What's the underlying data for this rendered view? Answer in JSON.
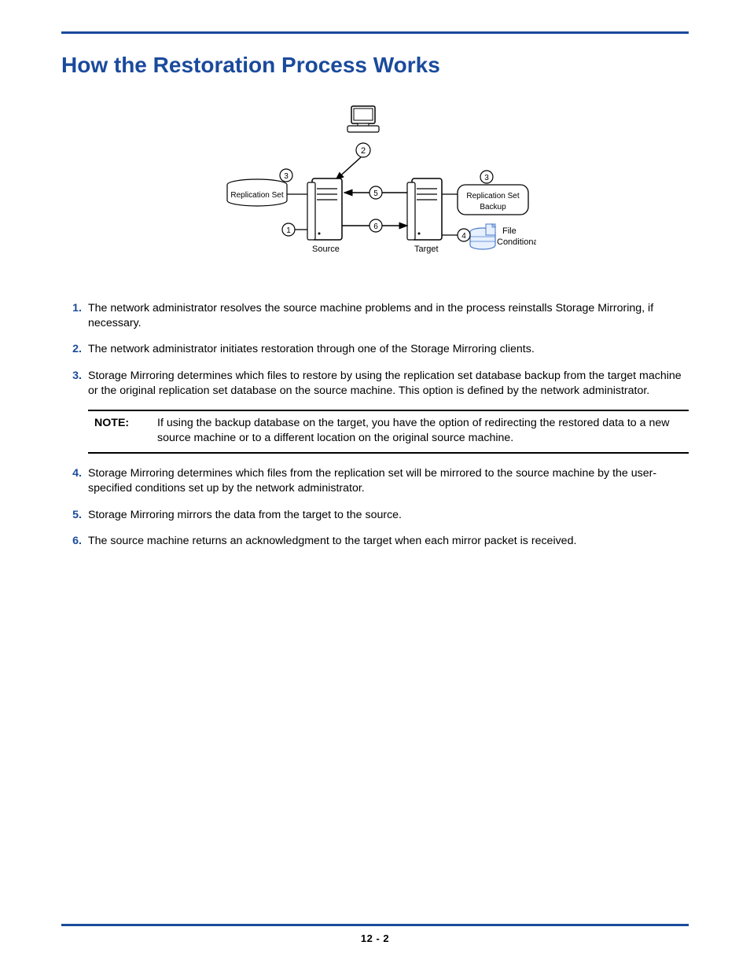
{
  "heading": "How the Restoration Process Works",
  "diagram": {
    "repl_set": "Replication Set",
    "source": "Source",
    "target": "Target",
    "repl_backup_l1": "Replication Set",
    "repl_backup_l2": "Backup",
    "file_l1": "File",
    "file_l2": "Conditionals",
    "n1": "1",
    "n2": "2",
    "n3": "3",
    "n4": "4",
    "n5": "5",
    "n6": "6"
  },
  "items": [
    {
      "num": "1.",
      "text": "The network administrator resolves the source machine problems and in the process reinstalls Storage Mirroring, if necessary."
    },
    {
      "num": "2.",
      "text": "The network administrator initiates restoration through one of the Storage Mirroring clients."
    },
    {
      "num": "3.",
      "text": "Storage Mirroring determines which files to restore by using the replication set database backup from the target machine or the original replication set database on the source machine.  This option is defined by the network administrator."
    },
    {
      "num": "4.",
      "text": "Storage Mirroring determines which files from the replication set will be mirrored to the source machine by the user-specified conditions set up by the network administrator."
    },
    {
      "num": "5.",
      "text": "Storage Mirroring mirrors the data from the target to the source."
    },
    {
      "num": "6.",
      "text": "The source machine returns an acknowledgment to the target when each mirror packet is received."
    }
  ],
  "note": {
    "label": "NOTE:",
    "text": "If using the backup database on the target, you have the option of redirecting the restored data to a new source machine or to a different location on the original source machine."
  },
  "page_number": "12 - 2"
}
